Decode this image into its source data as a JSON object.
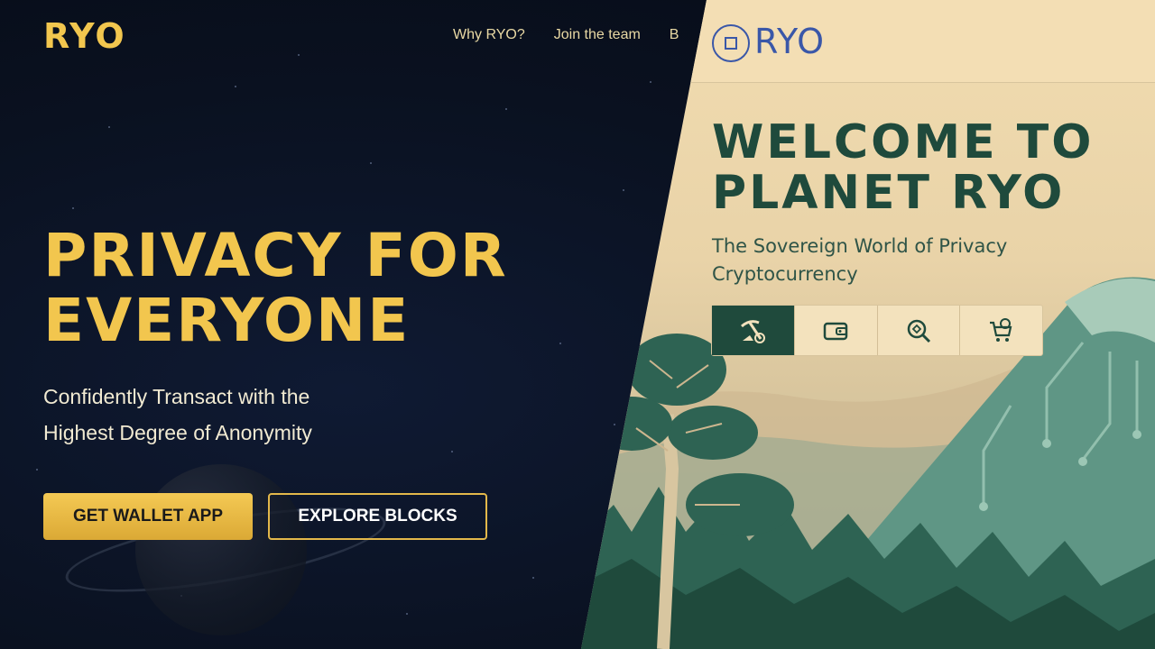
{
  "left": {
    "logo": "RYO",
    "nav": [
      "Why RYO?",
      "Join the team",
      "B"
    ],
    "hero_title_line1": "PRIVACY FOR",
    "hero_title_line2": "EVERYONE",
    "hero_sub_line1": "Confidently Transact with the",
    "hero_sub_line2": "Highest Degree of Anonymity",
    "btn_primary": "GET WALLET APP",
    "btn_outline": "EXPLORE BLOCKS"
  },
  "right": {
    "logo_text": "RYO",
    "welcome_line1": "WELCOME TO",
    "welcome_line2": "PLANET RYO",
    "sub_line1": "The Sovereign World of Privacy",
    "sub_line2": "Cryptocurrency",
    "icon_tabs": [
      "mining-icon",
      "wallet-icon",
      "explorer-icon",
      "shop-icon"
    ]
  },
  "colors": {
    "gold": "#f2c64e",
    "dark_bg": "#0a1120",
    "forest": "#1f4a3c",
    "cream": "#f3deb4",
    "blue_logo": "#3a57a8"
  }
}
